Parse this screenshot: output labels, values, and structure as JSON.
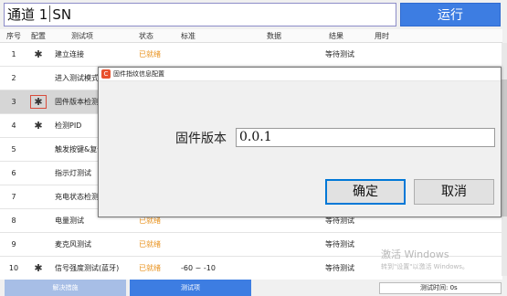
{
  "header": {
    "channel_label": "通道 1",
    "channel_value": "SN",
    "run_button": "运行"
  },
  "table": {
    "columns": [
      "序号",
      "配置",
      "测试项",
      "状态",
      "标准",
      "数据",
      "结果",
      "用时"
    ],
    "rows": [
      {
        "no": "1",
        "has_cfg": true,
        "item": "建立连接",
        "status": "已就绪",
        "standard": "",
        "data": "",
        "result": "等待测试",
        "time": ""
      },
      {
        "no": "2",
        "has_cfg": false,
        "item": "进入测试模式",
        "status": "",
        "standard": "",
        "data": "",
        "result": "",
        "time": ""
      },
      {
        "no": "3",
        "has_cfg": true,
        "item": "固件版本检测",
        "status": "",
        "standard": "",
        "data": "",
        "result": "",
        "time": ""
      },
      {
        "no": "4",
        "has_cfg": true,
        "item": "检测PID",
        "status": "",
        "standard": "",
        "data": "",
        "result": "",
        "time": ""
      },
      {
        "no": "5",
        "has_cfg": false,
        "item": "触发按键&复位",
        "status": "",
        "standard": "",
        "data": "",
        "result": "",
        "time": ""
      },
      {
        "no": "6",
        "has_cfg": false,
        "item": "指示灯测试",
        "status": "",
        "standard": "",
        "data": "",
        "result": "",
        "time": ""
      },
      {
        "no": "7",
        "has_cfg": false,
        "item": "充电状态检测",
        "status": "",
        "standard": "",
        "data": "",
        "result": "",
        "time": ""
      },
      {
        "no": "8",
        "has_cfg": false,
        "item": "电量测试",
        "status": "已就绪",
        "standard": "",
        "data": "",
        "result": "等待测试",
        "time": ""
      },
      {
        "no": "9",
        "has_cfg": false,
        "item": "麦克风测试",
        "status": "已就绪",
        "standard": "",
        "data": "",
        "result": "等待测试",
        "time": ""
      },
      {
        "no": "10",
        "has_cfg": true,
        "item": "信号强度测试(蓝牙)",
        "status": "已就绪",
        "standard": "-60 ~ -10",
        "data": "",
        "result": "等待测试",
        "time": ""
      }
    ]
  },
  "bottom": {
    "solve_button": "解决措施",
    "test_item_button": "测试项",
    "test_time": "测试时间: 0s"
  },
  "watermark": {
    "line1": "激活 Windows",
    "line2": "转到\"设置\"以激活 Windows。"
  },
  "dialog": {
    "title": "固件指纹信息配置",
    "icon_glyph": "C",
    "fw_label": "固件版本",
    "fw_value": "0.0.1",
    "ok_button": "确定",
    "cancel_button": "取消"
  },
  "colors": {
    "accent": "#3d7de2",
    "status_ready": "#e8901a",
    "selected_row": "#d6d6d6",
    "cfg_highlight": "#d84b3b"
  },
  "icons": {
    "config": "gear-icon",
    "dialog": "app-icon"
  },
  "selected_row_index": 2
}
